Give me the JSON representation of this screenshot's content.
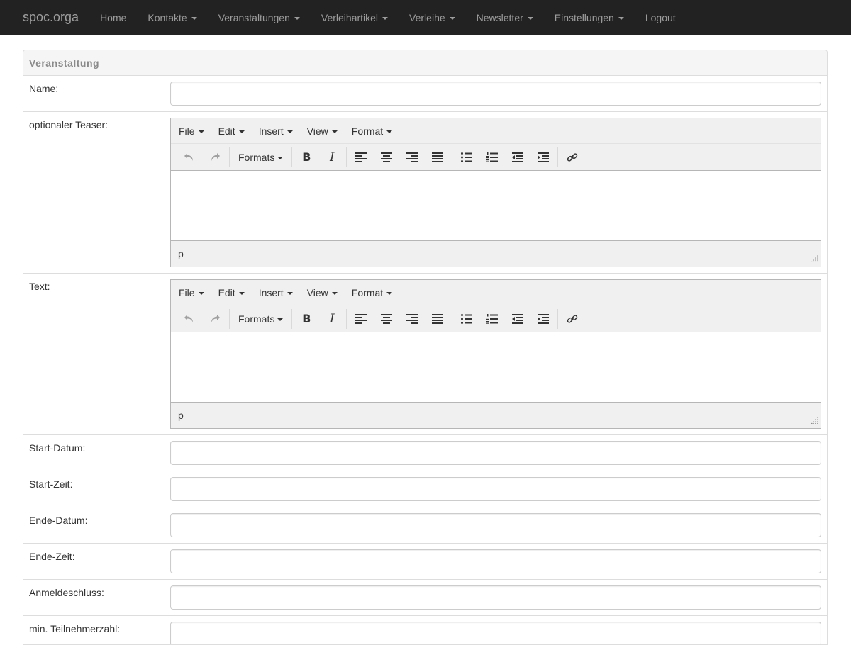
{
  "navbar": {
    "brand": "spoc.orga",
    "items": [
      {
        "label": "Home",
        "dropdown": false
      },
      {
        "label": "Kontakte",
        "dropdown": true
      },
      {
        "label": "Veranstaltungen",
        "dropdown": true
      },
      {
        "label": "Verleihartikel",
        "dropdown": true
      },
      {
        "label": "Verleihe",
        "dropdown": true
      },
      {
        "label": "Newsletter",
        "dropdown": true
      },
      {
        "label": "Einstellungen",
        "dropdown": true
      },
      {
        "label": "Logout",
        "dropdown": false
      }
    ]
  },
  "panel": {
    "title": "Veranstaltung"
  },
  "form": {
    "name_label": "Name:",
    "teaser_label": "optionaler Teaser:",
    "text_label": "Text:",
    "start_date_label": "Start-Datum:",
    "start_time_label": "Start-Zeit:",
    "end_date_label": "Ende-Datum:",
    "end_time_label": "Ende-Zeit:",
    "deadline_label": "Anmeldeschluss:",
    "min_participants_label": "min. Teilnehmerzahl:"
  },
  "editor": {
    "menu": [
      "File",
      "Edit",
      "Insert",
      "View",
      "Format"
    ],
    "formats_label": "Formats",
    "status_path": "p"
  },
  "colors": {
    "navbar_bg": "#222222",
    "navbar_text": "#9d9d9d",
    "panel_heading_bg": "#f5f5f5",
    "editor_chrome": "#f0f0f0"
  }
}
